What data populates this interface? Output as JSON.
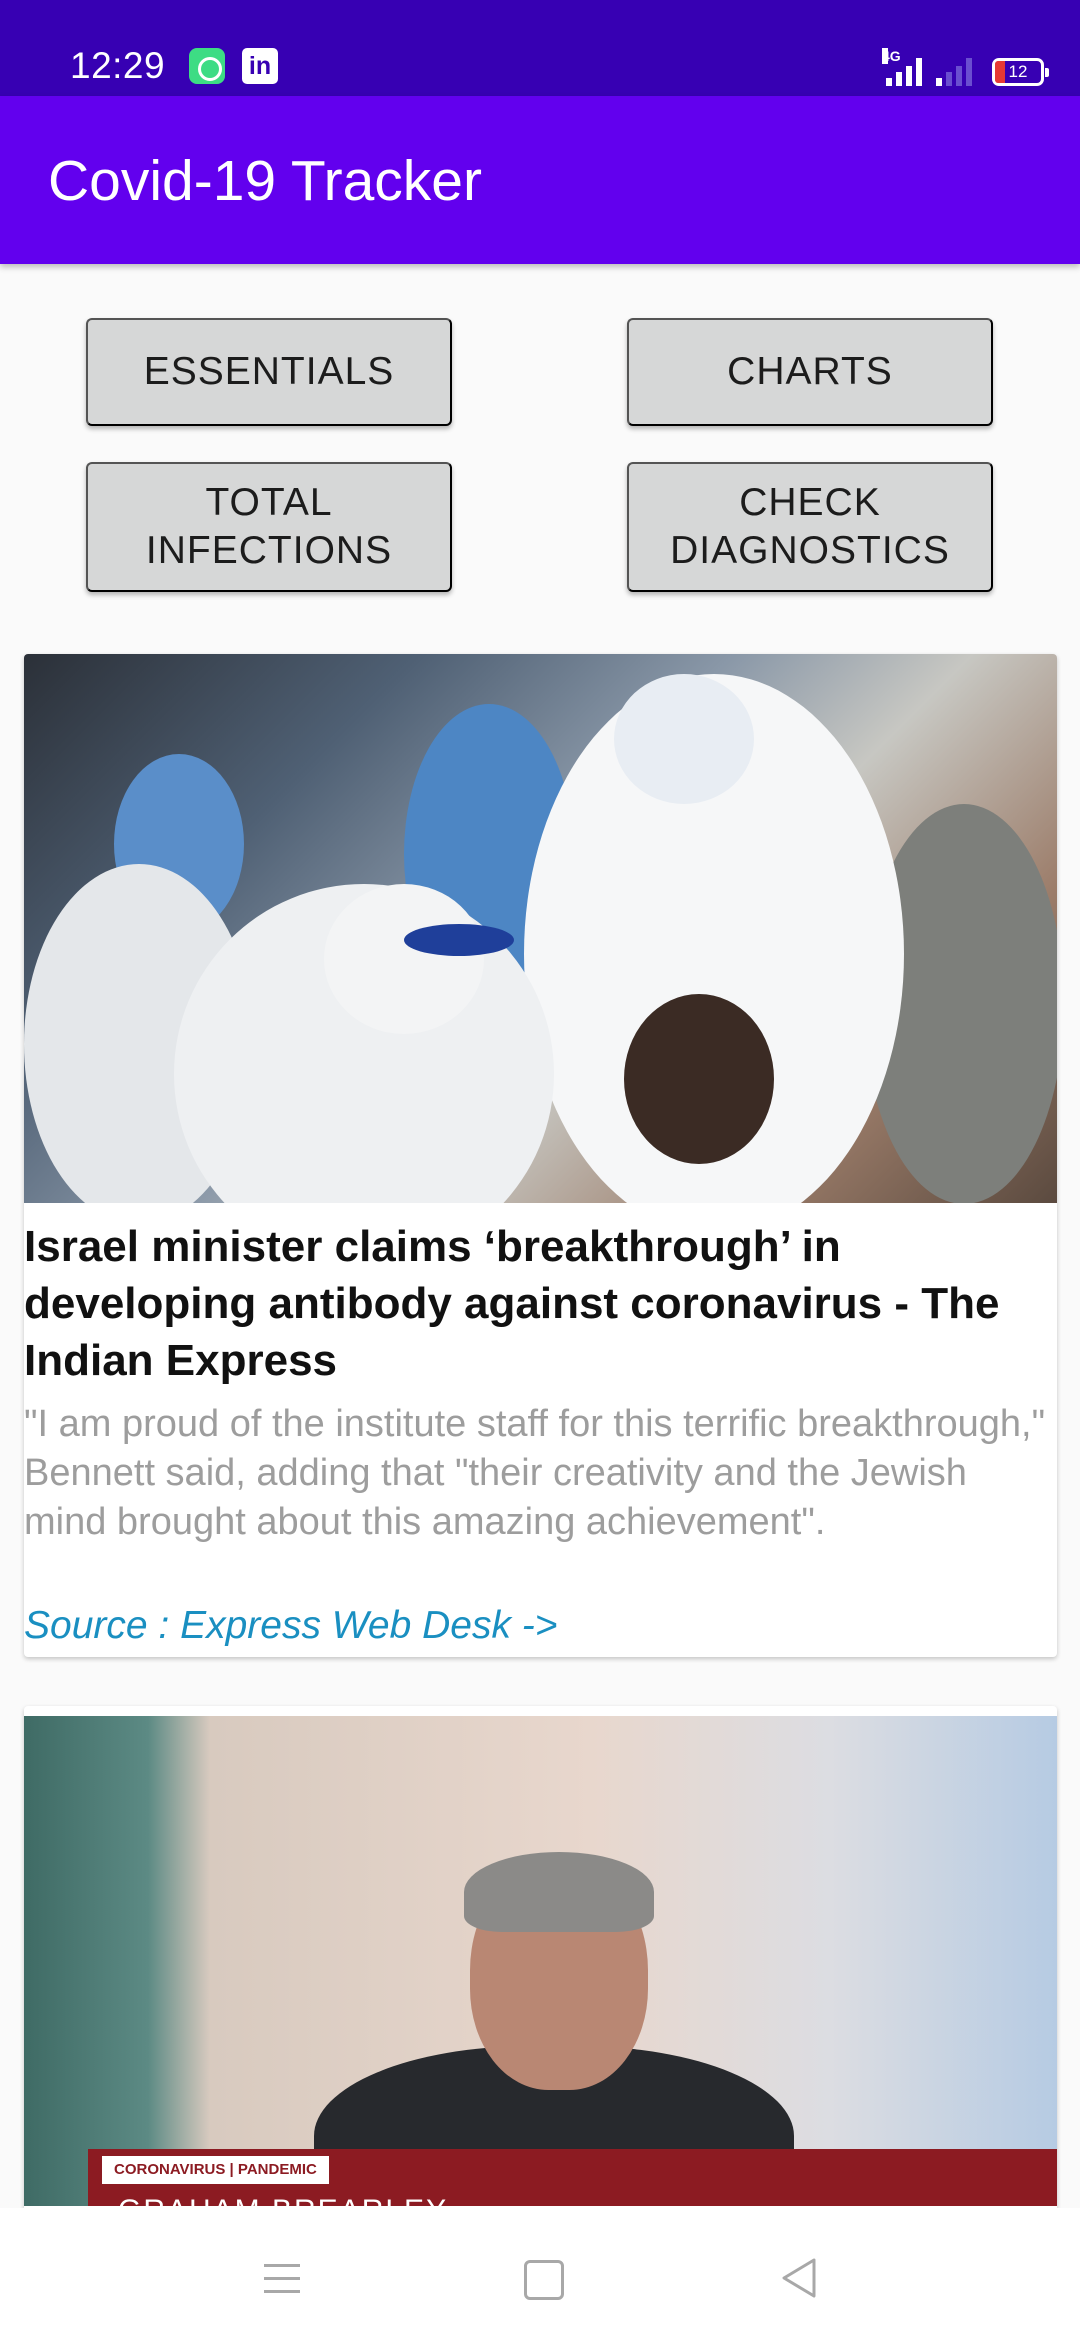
{
  "status_bar": {
    "time": "12:29",
    "app_icons": [
      "chat-bubble-icon",
      "linkedin-icon"
    ],
    "linkedin_glyph": "in",
    "network_tag": "4G",
    "battery_level": "12"
  },
  "app_bar": {
    "title": "Covid-19 Tracker",
    "color": "#6200ee"
  },
  "menu": {
    "essentials": "ESSENTIALS",
    "charts": "CHARTS",
    "total_infections": "TOTAL\nINFECTIONS",
    "check_diagnostics": "CHECK\nDIAGNOSTICS"
  },
  "news": [
    {
      "image": "testing-workers-photo",
      "title": "Israel minister claims ‘breakthrough’ in developing antibody against coronavirus - The Indian Express",
      "description": "\"I am proud of the institute staff for this terrific breakthrough,\" Bennett said, adding that \"their creativity and the Jewish mind brought about this amazing achievement\".",
      "source": "Source : Express Web Desk ->"
    },
    {
      "image": "news-interview-photo",
      "overlay_tag": "CORONAVIRUS | PANDEMIC",
      "overlay_name": "GRAHAM BREARLEY"
    }
  ],
  "nav_bar": [
    "menu-icon",
    "home-icon",
    "back-icon"
  ]
}
